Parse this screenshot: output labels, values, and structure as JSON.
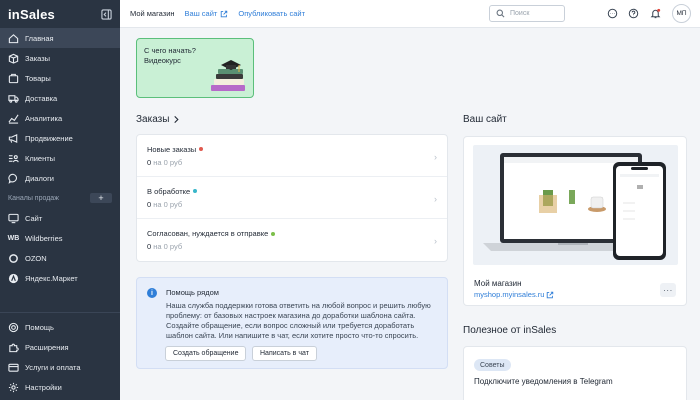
{
  "sidebar": {
    "logo": "inSales",
    "items": [
      {
        "label": "Главная",
        "icon": "home-icon",
        "active": true
      },
      {
        "label": "Заказы",
        "icon": "box-icon"
      },
      {
        "label": "Товары",
        "icon": "tag-icon"
      },
      {
        "label": "Доставка",
        "icon": "truck-icon"
      },
      {
        "label": "Аналитика",
        "icon": "chart-icon"
      },
      {
        "label": "Продвижение",
        "icon": "megaphone-icon"
      },
      {
        "label": "Клиенты",
        "icon": "users-icon"
      },
      {
        "label": "Диалоги",
        "icon": "chat-icon"
      }
    ],
    "channels_label": "Каналы продаж",
    "channels_add": "+",
    "channels": [
      {
        "label": "Сайт",
        "icon": "monitor-icon"
      },
      {
        "label": "Wildberries",
        "badge": "WB"
      },
      {
        "label": "OZON",
        "icon": "ozon-icon"
      },
      {
        "label": "Яндекс.Маркет",
        "icon": "yandex-market-icon"
      }
    ],
    "bottom": [
      {
        "label": "Помощь",
        "icon": "help-icon"
      },
      {
        "label": "Расширения",
        "icon": "puzzle-icon"
      },
      {
        "label": "Услуги и оплата",
        "icon": "wallet-icon"
      },
      {
        "label": "Настройки",
        "icon": "gear-icon"
      }
    ]
  },
  "topbar": {
    "store": "Мой магазин",
    "site_link": "Ваш сайт",
    "publish_link": "Опубликовать сайт",
    "search_placeholder": "Поиск",
    "avatar": "МП"
  },
  "promo": {
    "line1": "С чего начать?",
    "line2": "Видеокурс"
  },
  "orders": {
    "title": "Заказы",
    "rows": [
      {
        "label": "Новые заказы",
        "count": "0",
        "suffix": "на 0 руб",
        "dot": "#e05a4f"
      },
      {
        "label": "В обработке",
        "count": "0",
        "suffix": "на 0 руб",
        "dot": "#38b6c9"
      },
      {
        "label": "Согласован, нуждается в отправке",
        "count": "0",
        "suffix": "на 0 руб",
        "dot": "#7cbf4a"
      }
    ]
  },
  "help": {
    "title": "Помощь рядом",
    "text": "Наша служба поддержки готова ответить на любой вопрос и решить любую проблему: от базовых настроек магазина до доработки шаблона сайта. Создайте обращение, если вопрос сложный или требуется доработать шаблон сайта. Или напишите в чат, если хотите просто что-то спросить.",
    "btn_ticket": "Создать обращение",
    "btn_chat": "Написать в чат"
  },
  "site": {
    "title": "Ваш сайт",
    "store_name": "Мой магазин",
    "url": "myshop.myinsales.ru"
  },
  "useful": {
    "title": "Полезное от inSales",
    "chip": "Советы",
    "text": "Подключите уведомления в Telegram"
  }
}
